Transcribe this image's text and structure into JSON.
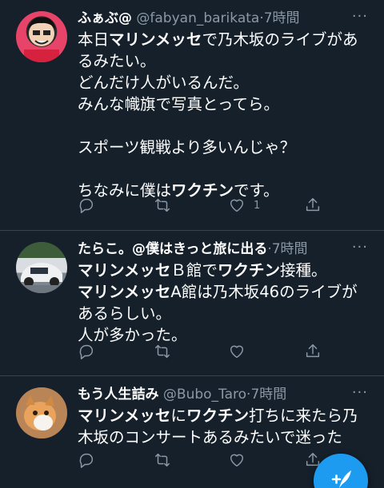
{
  "tweets": [
    {
      "name": "ふぁぶ@",
      "handle": "@fabyan_barikata",
      "time": "7時間",
      "body_segments": [
        {
          "t": "本日",
          "b": false
        },
        {
          "t": "マリンメッセ",
          "b": true
        },
        {
          "t": "で乃木坂のライブがあるみたい。\nどんだけ人がいるんだ。\nみんな幟旗で写真とってら。\n\nスポーツ観戦より多いんじゃ？\n\nちなみに僕は",
          "b": false
        },
        {
          "t": "ワクチン",
          "b": true
        },
        {
          "t": "です。",
          "b": false
        }
      ],
      "like_count": "1"
    },
    {
      "name": "たらこ。@僕はきっと旅に出る",
      "handle": "",
      "time": "7時間",
      "body_segments": [
        {
          "t": "マリンメッセ",
          "b": true
        },
        {
          "t": "Ｂ館で",
          "b": false
        },
        {
          "t": "ワクチン",
          "b": true
        },
        {
          "t": "接種。\n",
          "b": false
        },
        {
          "t": "マリンメッセ",
          "b": true
        },
        {
          "t": "A館は乃木坂46のライブがあるらしい。\n人が多かった。",
          "b": false
        }
      ],
      "like_count": ""
    },
    {
      "name": "もう人生詰み",
      "handle": "@Bubo_Taro",
      "time": "7時間",
      "body_segments": [
        {
          "t": "マリンメッセ",
          "b": true
        },
        {
          "t": "に",
          "b": false
        },
        {
          "t": "ワクチン",
          "b": true
        },
        {
          "t": "打ちに来たら乃木坂のコンサートあるみたいで迷った",
          "b": false
        }
      ],
      "like_count": ""
    }
  ],
  "more_label": "···",
  "dot": "·",
  "colors": {
    "background": "#15202b",
    "accent": "#1d9bf0",
    "muted": "#8b98a5",
    "divider": "#38444d"
  },
  "icons": [
    "reply-icon",
    "retweet-icon",
    "like-icon",
    "share-icon",
    "compose-icon"
  ]
}
